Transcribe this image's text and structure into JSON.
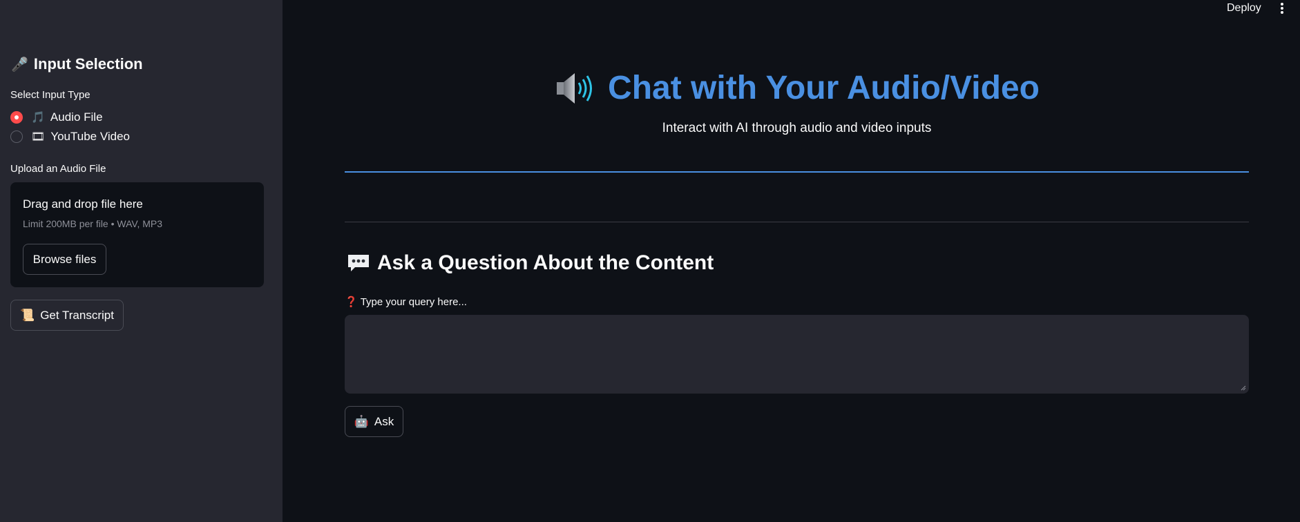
{
  "header": {
    "deploy_label": "Deploy"
  },
  "sidebar": {
    "title": "Input Selection",
    "title_icon": "microphone-icon",
    "input_type_label": "Select Input Type",
    "options": [
      {
        "label": "Audio File",
        "icon": "musical-notes-icon",
        "checked": true
      },
      {
        "label": "YouTube Video",
        "icon": "film-icon",
        "checked": false
      }
    ],
    "upload_label": "Upload an Audio File",
    "dropzone": {
      "title": "Drag and drop file here",
      "subtitle": "Limit 200MB per file • WAV, MP3",
      "browse_label": "Browse files"
    },
    "transcript_label": "Get Transcript",
    "transcript_icon": "scroll-icon"
  },
  "main": {
    "title": "Chat with Your Audio/Video",
    "title_icon": "speaker-icon",
    "subtitle": "Interact with AI through audio and video inputs",
    "section_title": "Ask a Question About the Content",
    "section_icon": "speech-bubble-icon",
    "query_label": "Type your query here...",
    "query_label_icon": "question-mark-icon",
    "query_value": "",
    "ask_label": "Ask",
    "ask_icon": "robot-icon"
  },
  "colors": {
    "accent_blue": "#4a90e2",
    "accent_red": "#ff4b4b",
    "background": "#0e1117",
    "sidebar_bg": "#262730"
  }
}
